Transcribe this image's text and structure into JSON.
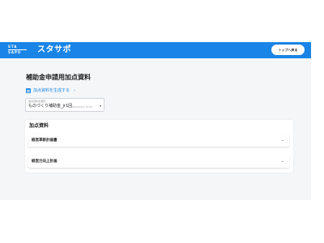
{
  "header": {
    "logo_line1": "STA",
    "logo_line2": "SAPO",
    "brand": "スタサポ",
    "top_button": "トップへ戻る"
  },
  "page": {
    "title": "補助金申請用加点資料",
    "generate_link": "加点資料を生成する",
    "generate_chevron": "›"
  },
  "select": {
    "label": "加点資料を選択",
    "value": "ものづくり補助金_jr1回",
    "meta": "2024/10/4 14:51",
    "arrow": "▾"
  },
  "card": {
    "title": "加点資料",
    "items": [
      {
        "label": "経営革新計画書",
        "chevron": "⌄"
      },
      {
        "label": "経営力向上計画",
        "chevron": "⌄"
      }
    ]
  },
  "colors": {
    "header": "#1a85e6",
    "link": "#1a85e6",
    "background": "#f5f6f8"
  },
  "icons": [
    "document-icon",
    "chevron-right-icon",
    "chevron-down-icon"
  ]
}
